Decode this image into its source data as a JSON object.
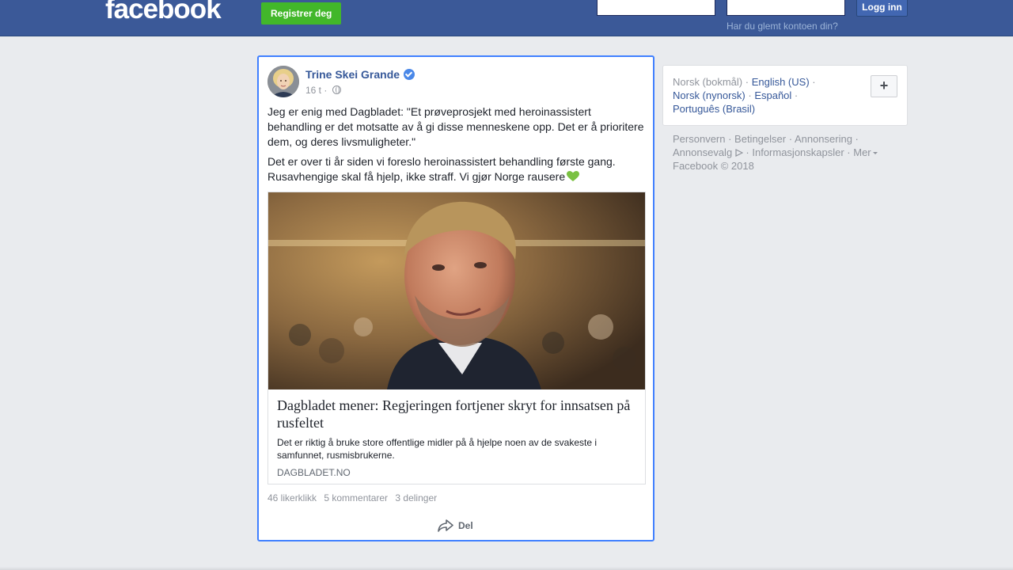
{
  "header": {
    "logo": "facebook",
    "register_label": "Registrer deg",
    "login_label": "Logg inn",
    "forgot_link": "Har du glemt kontoen din?",
    "brand_color": "#3b5998"
  },
  "post": {
    "author": "Trine Skei Grande",
    "verified": true,
    "time": "16 t",
    "separator": "·",
    "paragraph1": "Jeg er enig med Dagbladet: \"Et prøveprosjekt med heroinassistert behandling er det motsatte av å gi disse menneskene opp. Det er å prioritere dem, og deres livsmuligheter.\"",
    "paragraph2": "Det er over ti år siden vi foreslo heroinassistert behandling første gang. Rusavhengige skal få hjelp, ikke straff. Vi gjør Norge rausere",
    "link": {
      "title": "Dagbladet mener: Regjeringen fortjener skryt for innsatsen på rusfeltet",
      "description": "Det er riktig å bruke store offentlige midler på å hjelpe noen av de svakeste i samfunnet, rusmisbrukerne.",
      "domain": "DAGBLADET.NO"
    },
    "likes": "46 likerklikk",
    "comments": "5 kommentarer",
    "shares": "3 delinger",
    "share_label": "Del",
    "highlight_color": "#4080ff"
  },
  "languages": {
    "current": "Norsk (bokmål)",
    "options": [
      "English (US)",
      "Norsk (nynorsk)",
      "Español",
      "Português (Brasil)"
    ],
    "add_label": "+"
  },
  "footer": {
    "links": [
      "Personvern",
      "Betingelser",
      "Annonsering",
      "Annonsevalg",
      "Informasjonskapsler",
      "Mer"
    ],
    "copyright": "Facebook © 2018"
  }
}
